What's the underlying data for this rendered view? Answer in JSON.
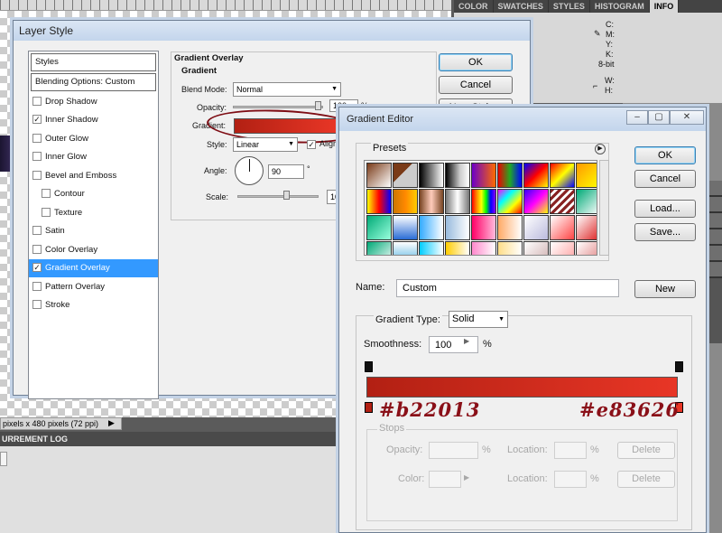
{
  "workspace": {
    "status_text": "pixels x 480 pixels (72 ppi)",
    "measurement_log_label": "URREMENT LOG"
  },
  "right_panel": {
    "tabs": [
      "COLOR",
      "SWATCHES",
      "STYLES",
      "HISTOGRAM",
      "INFO"
    ],
    "info_lines_1": [
      "C:",
      "M:",
      "Y:",
      "K:",
      "8-bit"
    ],
    "info_lines_2": [
      "W:",
      "H:"
    ]
  },
  "layer_style": {
    "title": "Layer Style",
    "list": {
      "styles_header": "Styles",
      "blending_header": "Blending Options: Custom",
      "items": [
        {
          "label": "Drop Shadow",
          "checked": false
        },
        {
          "label": "Inner Shadow",
          "checked": true
        },
        {
          "label": "Outer Glow",
          "checked": false
        },
        {
          "label": "Inner Glow",
          "checked": false
        },
        {
          "label": "Bevel and Emboss",
          "checked": false
        },
        {
          "label": "Contour",
          "checked": false
        },
        {
          "label": "Texture",
          "checked": false
        },
        {
          "label": "Satin",
          "checked": false
        },
        {
          "label": "Color Overlay",
          "checked": false
        },
        {
          "label": "Gradient Overlay",
          "checked": true
        },
        {
          "label": "Pattern Overlay",
          "checked": false
        },
        {
          "label": "Stroke",
          "checked": false
        }
      ]
    },
    "panel": {
      "section_title": "Gradient Overlay",
      "group_title": "Gradient",
      "blend_mode_label": "Blend Mode:",
      "blend_mode_value": "Normal",
      "opacity_label": "Opacity:",
      "opacity_value": "100",
      "opacity_unit": "%",
      "gradient_label": "Gradient:",
      "style_label": "Style:",
      "style_value": "Linear",
      "align_label": "Align",
      "angle_label": "Angle:",
      "angle_value": "90",
      "angle_unit": "°",
      "scale_label": "Scale:",
      "scale_value": "10"
    },
    "buttons": {
      "ok": "OK",
      "cancel": "Cancel",
      "new_style": "New Style..."
    }
  },
  "gradient_editor": {
    "title": "Gradient Editor",
    "presets_label": "Presets",
    "buttons": {
      "ok": "OK",
      "cancel": "Cancel",
      "load": "Load...",
      "save": "Save...",
      "new": "New"
    },
    "name_label": "Name:",
    "name_value": "Custom",
    "gradient_type_label": "Gradient Type:",
    "gradient_type_value": "Solid",
    "smoothness_label": "Smoothness:",
    "smoothness_value": "100",
    "smoothness_unit": "%",
    "annotation_left": "#b22013",
    "annotation_right": "#e83626",
    "stops": {
      "label": "Stops",
      "opacity_label": "Opacity:",
      "location_label": "Location:",
      "color_label": "Color:",
      "percent": "%",
      "delete_label": "Delete"
    },
    "colors": {
      "start": "#b22013",
      "end": "#e83626"
    }
  }
}
